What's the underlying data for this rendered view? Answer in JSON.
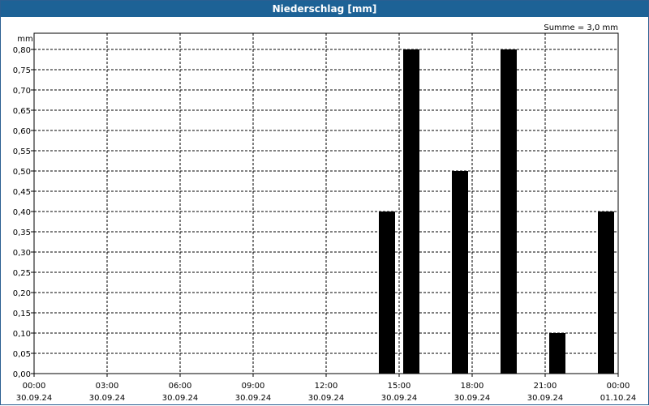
{
  "window": {
    "title": "Niederschlag [mm]"
  },
  "summary": "Summe = 3,0 mm",
  "colors": {
    "titlebar": "#1d6296",
    "bars": "#000000",
    "grid": "#000000"
  },
  "chart_data": {
    "type": "bar",
    "title": "Niederschlag [mm]",
    "ylabel": "mm",
    "xlabel": "",
    "ylim": [
      0,
      0.8
    ],
    "grid": true,
    "y_ticks": [
      "0,00",
      "0,05",
      "0,10",
      "0,15",
      "0,20",
      "0,25",
      "0,30",
      "0,35",
      "0,40",
      "0,45",
      "0,50",
      "0,55",
      "0,60",
      "0,65",
      "0,70",
      "0,75",
      "0,80"
    ],
    "x_ticks": [
      {
        "time": "00:00",
        "date": "30.09.24",
        "hour": 0
      },
      {
        "time": "03:00",
        "date": "30.09.24",
        "hour": 3
      },
      {
        "time": "06:00",
        "date": "30.09.24",
        "hour": 6
      },
      {
        "time": "09:00",
        "date": "30.09.24",
        "hour": 9
      },
      {
        "time": "12:00",
        "date": "30.09.24",
        "hour": 12
      },
      {
        "time": "15:00",
        "date": "30.09.24",
        "hour": 15
      },
      {
        "time": "18:00",
        "date": "30.09.24",
        "hour": 18
      },
      {
        "time": "21:00",
        "date": "30.09.24",
        "hour": 21
      },
      {
        "time": "00:00",
        "date": "01.10.24",
        "hour": 24
      }
    ],
    "bars": [
      {
        "hour": 14.5,
        "value": 0.4
      },
      {
        "hour": 15.5,
        "value": 0.8
      },
      {
        "hour": 17.5,
        "value": 0.5
      },
      {
        "hour": 19.5,
        "value": 0.8
      },
      {
        "hour": 21.5,
        "value": 0.1
      },
      {
        "hour": 23.5,
        "value": 0.4
      }
    ]
  }
}
